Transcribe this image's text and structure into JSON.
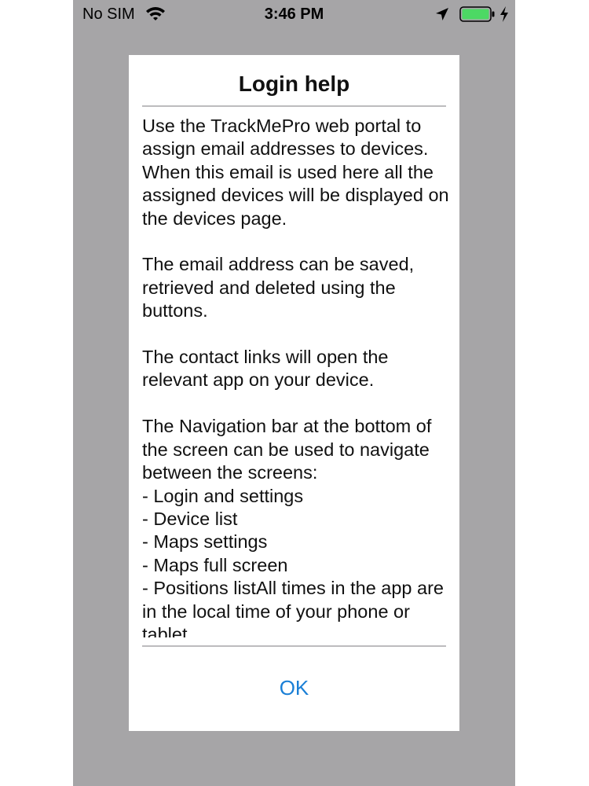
{
  "status_bar": {
    "carrier": "No SIM",
    "time": "3:46 PM",
    "icons": [
      "wifi-icon",
      "location-arrow-icon",
      "battery-icon",
      "charging-bolt-icon"
    ],
    "battery_color": "#4cd964"
  },
  "dialog": {
    "title": "Login help",
    "body": "Use the TrackMePro web portal to assign email addresses to devices. When this email is used here all the assigned devices will be displayed on the devices page.\n\nThe email address can be saved, retrieved and deleted using the buttons.\n\nThe contact links will open the relevant app on your device.\n\nThe Navigation bar at the bottom of the screen can be used to navigate between the screens:\n - Login and settings\n - Device list\n - Maps settings\n - Maps full screen\n - Positions listAll times in the app are in the local time of your phone or tablet",
    "ok_label": "OK"
  },
  "colors": {
    "overlay": "#a6a5a7",
    "link": "#1a7fd6"
  }
}
